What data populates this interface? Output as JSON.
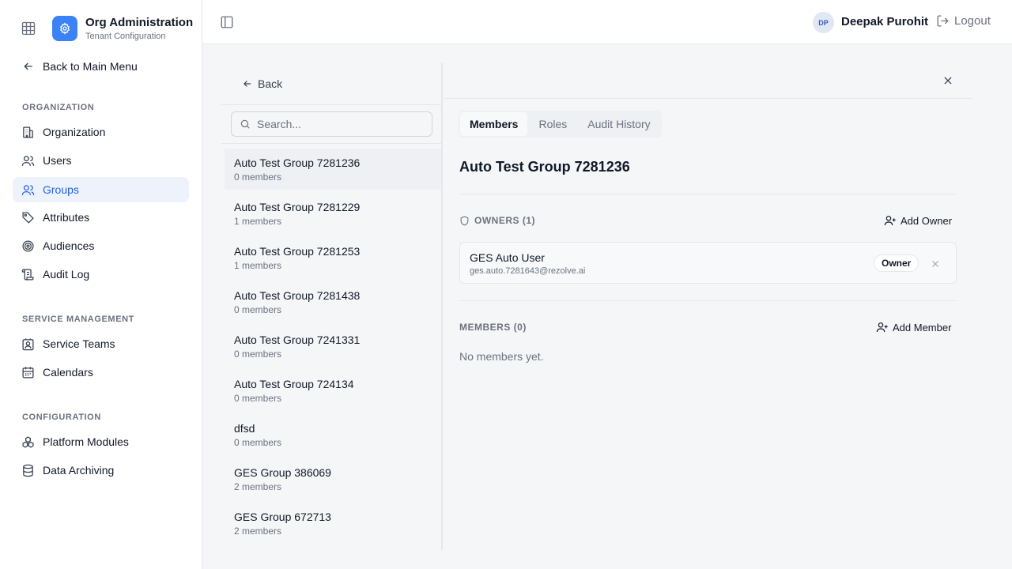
{
  "sidebar": {
    "title": "Org Administration",
    "subtitle": "Tenant Configuration",
    "back_label": "Back to Main Menu",
    "sections": [
      {
        "label": "ORGANIZATION",
        "items": [
          {
            "label": "Organization",
            "icon": "building-icon"
          },
          {
            "label": "Users",
            "icon": "user-icon"
          },
          {
            "label": "Groups",
            "icon": "users-icon",
            "active": true
          },
          {
            "label": "Attributes",
            "icon": "tag-icon"
          },
          {
            "label": "Audiences",
            "icon": "target-icon"
          },
          {
            "label": "Audit Log",
            "icon": "scroll-icon"
          }
        ]
      },
      {
        "label": "SERVICE MANAGEMENT",
        "items": [
          {
            "label": "Service Teams",
            "icon": "contact-icon"
          },
          {
            "label": "Calendars",
            "icon": "calendar-icon"
          }
        ]
      },
      {
        "label": "CONFIGURATION",
        "items": [
          {
            "label": "Platform Modules",
            "icon": "boxes-icon"
          },
          {
            "label": "Data Archiving",
            "icon": "database-icon"
          }
        ]
      }
    ]
  },
  "header": {
    "user_initials": "DP",
    "user_name": "Deepak Purohit",
    "logout_label": "Logout"
  },
  "group_list": {
    "back_label": "Back",
    "search_placeholder": "Search...",
    "groups": [
      {
        "name": "Auto Test Group 7281236",
        "members": "0 members",
        "selected": true
      },
      {
        "name": "Auto Test Group 7281229",
        "members": "1 members"
      },
      {
        "name": "Auto Test Group 7281253",
        "members": "1 members"
      },
      {
        "name": "Auto Test Group 7281438",
        "members": "0 members"
      },
      {
        "name": "Auto Test Group 7241331",
        "members": "0 members"
      },
      {
        "name": "Auto Test Group 724134",
        "members": "0 members"
      },
      {
        "name": "dfsd",
        "members": "0 members"
      },
      {
        "name": "GES Group 386069",
        "members": "2 members"
      },
      {
        "name": "GES Group 672713",
        "members": "2 members"
      }
    ]
  },
  "detail": {
    "tabs": [
      "Members",
      "Roles",
      "Audit History"
    ],
    "active_tab": "Members",
    "group_title": "Auto Test Group 7281236",
    "owners_heading": "OWNERS (1)",
    "add_owner_label": "Add Owner",
    "owner": {
      "name": "GES Auto User",
      "email": "ges.auto.7281643@rezolve.ai",
      "badge": "Owner"
    },
    "members_heading": "MEMBERS (0)",
    "add_member_label": "Add Member",
    "empty_members": "No members yet."
  },
  "colors": {
    "accent": "#2563eb",
    "logo_bg": "#3b82f6",
    "active_nav_bg": "#eef2fb"
  }
}
